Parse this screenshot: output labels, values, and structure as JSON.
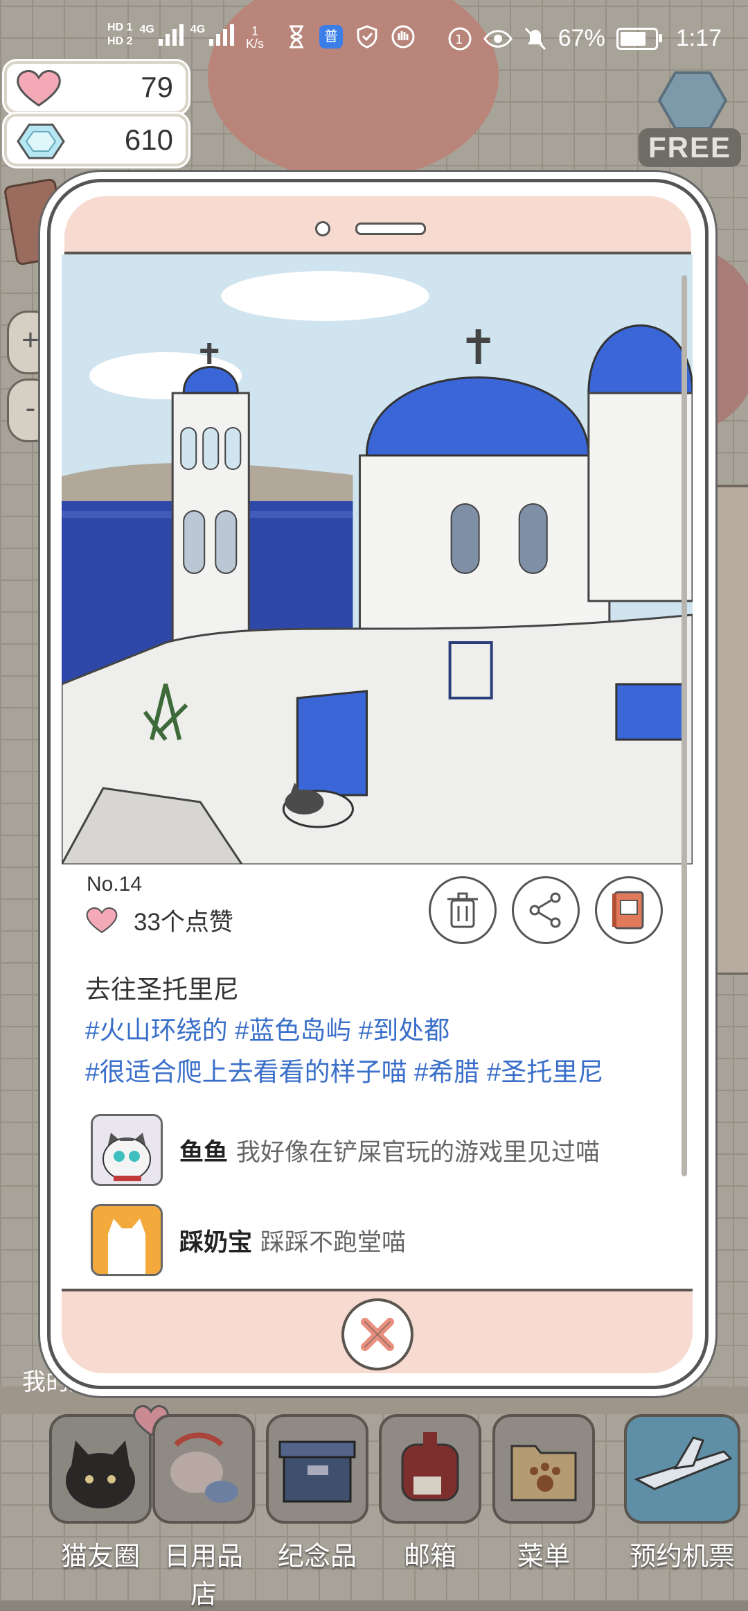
{
  "status_bar": {
    "hd1": "HD 1",
    "hd2": "HD 2",
    "sig1": "4G",
    "sig2": "4G",
    "speed_value": "1",
    "speed_unit": "K/s",
    "battery_percent": "67%",
    "time": "1:17"
  },
  "currency": {
    "hearts": "79",
    "gems": "610"
  },
  "side": {
    "free_badge": "FREE",
    "zoom_in": "+",
    "zoom_out": "-"
  },
  "post": {
    "number": "No.14",
    "likes": "33个点赞",
    "title": "去往圣托里尼",
    "tags_line1": "#火山环绕的 #蓝色岛屿 #到处都",
    "tags_line2": "#很适合爬上去看看的样子喵 #希腊 #圣托里尼",
    "comments": [
      {
        "name": "鱼鱼",
        "text": "我好像在铲屎官玩的游戏里见过喵"
      },
      {
        "name": "踩奶宝",
        "text": "踩踩不跑堂喵"
      }
    ]
  },
  "bottom_nav": [
    {
      "label": "猫友圈"
    },
    {
      "label": "日用品店"
    },
    {
      "label": "纪念品"
    },
    {
      "label": "邮箱"
    },
    {
      "label": "菜单"
    },
    {
      "label": "预约机票"
    }
  ],
  "partial_label": "我的房",
  "colors": {
    "frame_pink": "#f7dbd1",
    "tag_blue": "#3a6fc9",
    "heart_pink": "#f4a9b6",
    "dome_blue": "#3a66d8"
  }
}
